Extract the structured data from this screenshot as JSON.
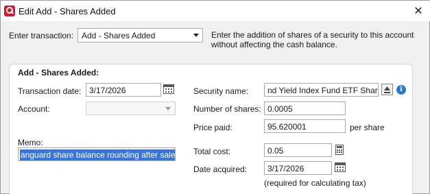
{
  "window": {
    "title": "Edit Add - Shares Added",
    "close_glyph": "✕"
  },
  "top": {
    "enter_transaction_label": "Enter transaction:",
    "transaction_type": "Add - Shares Added",
    "description": "Enter the addition of shares of a security to this account without affecting the cash balance."
  },
  "panel": {
    "title": "Add - Shares Added:",
    "transaction_date_label": "Transaction date:",
    "transaction_date": "3/17/2026",
    "account_label": "Account:",
    "account_value": "",
    "memo_label": "Memo:",
    "memo_value": "anguard share balance rounding after sale",
    "security_name_label": "Security name:",
    "security_name": "nd Yield Index Fund ETF Shares",
    "number_of_shares_label": "Number of shares:",
    "number_of_shares": "0.0005",
    "price_paid_label": "Price paid:",
    "price_paid": "95.620001",
    "per_share_label": "per share",
    "total_cost_label": "Total cost:",
    "total_cost": "0.05",
    "date_acquired_label": "Date acquired:",
    "date_acquired": "3/17/2026",
    "tax_note": "(required for calculating tax)"
  },
  "icons": {
    "app_logo": "quicken-logo-icon",
    "calendar": "calendar-icon",
    "calculator": "calculator-icon",
    "security_picker": "security-list-icon",
    "info": "info-icon",
    "info_glyph": "i"
  },
  "colors": {
    "brand": "#c8202f",
    "selection": "#3875d7",
    "info": "#2f78d0"
  }
}
